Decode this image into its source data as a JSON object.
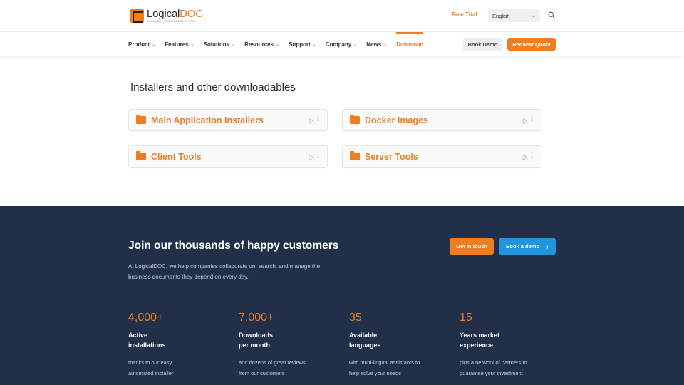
{
  "header": {
    "logo": {
      "name_part1": "Logical",
      "name_part2": "DOC",
      "tagline": "DOCUMENT MANAGEMENT SYSTEM"
    },
    "free_trial": "Free Trial",
    "language": "English",
    "nav": [
      {
        "label": "Product",
        "has_dropdown": true
      },
      {
        "label": "Features",
        "has_dropdown": true
      },
      {
        "label": "Solutions",
        "has_dropdown": true
      },
      {
        "label": "Resources",
        "has_dropdown": true
      },
      {
        "label": "Support",
        "has_dropdown": true
      },
      {
        "label": "Company",
        "has_dropdown": true
      },
      {
        "label": "News",
        "has_dropdown": true
      },
      {
        "label": "Download",
        "has_dropdown": false,
        "active": true
      }
    ],
    "book_demo": "Book Demo",
    "request_quote": "Request Quote"
  },
  "main": {
    "title": "Installers and other downloadables",
    "folders": [
      {
        "label": "Main Application Installers"
      },
      {
        "label": "Docker Images"
      },
      {
        "label": "Client Tools"
      },
      {
        "label": "Server Tools"
      }
    ]
  },
  "cta": {
    "title": "Join our thousands of happy customers",
    "get_in_touch": "Get in touch",
    "book_a_demo": "Book a demo",
    "description": "At LogicalDOC, we help companies collaborate on, search, and manage the business documents they depend on every day.",
    "stats": [
      {
        "number": "4,000+",
        "label_line1": "Active",
        "label_line2": "installations",
        "desc_line1": "thanks to our easy",
        "desc_line2": "automated installer"
      },
      {
        "number": "7,000+",
        "label_line1": "Downloads",
        "label_line2": "per month",
        "desc_line1": "and dozens of great reviews",
        "desc_line2": "from our customers"
      },
      {
        "number": "35",
        "label_line1": "Available",
        "label_line2": "languages",
        "desc_line1": "with multi-lingual assistants to",
        "desc_line2": "help solve your needs"
      },
      {
        "number": "15",
        "label_line1": "Years market",
        "label_line2": "experience",
        "desc_line1": "plus a network of partners to",
        "desc_line2": "guarantee your investment"
      }
    ]
  },
  "colors": {
    "accent": "#f07d1f",
    "band_bg": "#213048",
    "demo_blue": "#2196e0"
  },
  "icons": [
    "search-icon",
    "chevron-down-icon",
    "folder-icon",
    "rss-icon",
    "kebab-menu-icon",
    "chevron-right-icon"
  ]
}
